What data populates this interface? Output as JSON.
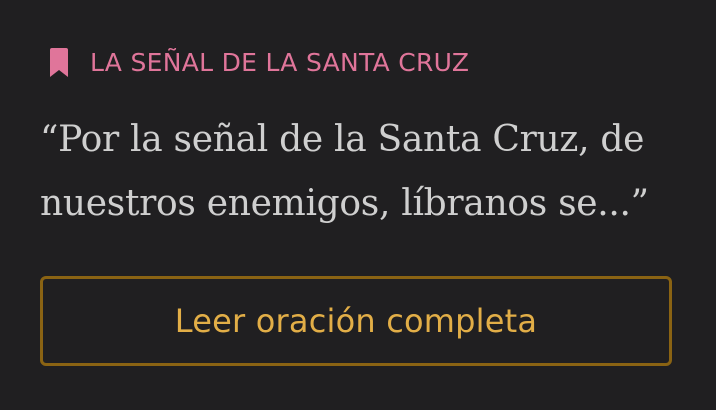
{
  "card": {
    "title": "LA SEÑAL DE LA SANTA CRUZ",
    "icon": "bookmark-icon",
    "quote": "“Por la señal de la Santa Cruz, de nuestros enemigos, líbranos se...”",
    "button_label": "Leer oración completa"
  },
  "colors": {
    "background": "#201f21",
    "title": "#e0759a",
    "quote_text": "#cfcfcf",
    "button_text": "#e2ae47",
    "button_border": "#8a6313"
  }
}
